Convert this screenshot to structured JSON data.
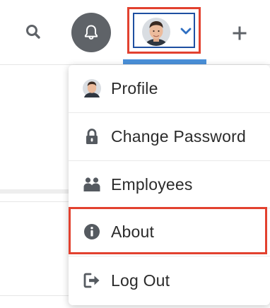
{
  "header": {
    "search_icon": "search-icon",
    "notifications_icon": "bell-icon",
    "user_menu_icon": "chevron-down-icon",
    "add_icon": "plus-icon"
  },
  "colors": {
    "highlight": "#e2412f",
    "accent_blue": "#4a90d9",
    "bell_bg": "#5f6368",
    "icon_gray": "#5f6368",
    "text": "#2b2b2b"
  },
  "user_menu": {
    "items": [
      {
        "label": "Profile",
        "icon": "avatar-icon"
      },
      {
        "label": "Change Password",
        "icon": "lock-icon"
      },
      {
        "label": "Employees",
        "icon": "people-icon"
      },
      {
        "label": "About",
        "icon": "info-icon"
      },
      {
        "label": "Log Out",
        "icon": "logout-icon"
      }
    ]
  }
}
